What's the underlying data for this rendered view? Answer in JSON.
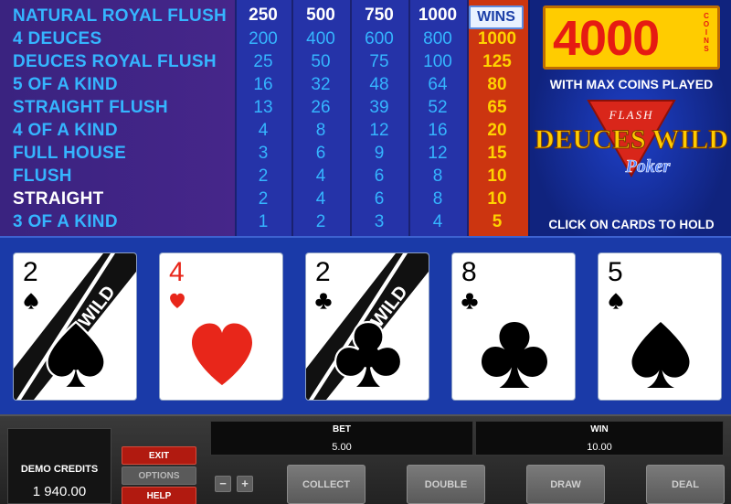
{
  "paytable": {
    "coin_headers": [
      "250",
      "500",
      "750",
      "1000"
    ],
    "wins_label": "WINS",
    "rows": [
      {
        "hand": "NATURAL ROYAL FLUSH",
        "pays": [
          "",
          "",
          "",
          ""
        ],
        "win": ""
      },
      {
        "hand": "4 DEUCES",
        "pays": [
          "200",
          "400",
          "600",
          "800"
        ],
        "win": "1000"
      },
      {
        "hand": "DEUCES ROYAL FLUSH",
        "pays": [
          "25",
          "50",
          "75",
          "100"
        ],
        "win": "125"
      },
      {
        "hand": "5 OF A KIND",
        "pays": [
          "16",
          "32",
          "48",
          "64"
        ],
        "win": "80"
      },
      {
        "hand": "STRAIGHT FLUSH",
        "pays": [
          "13",
          "26",
          "39",
          "52"
        ],
        "win": "65"
      },
      {
        "hand": "4 OF A KIND",
        "pays": [
          "4",
          "8",
          "12",
          "16"
        ],
        "win": "20"
      },
      {
        "hand": "FULL HOUSE",
        "pays": [
          "3",
          "6",
          "9",
          "12"
        ],
        "win": "15"
      },
      {
        "hand": "FLUSH",
        "pays": [
          "2",
          "4",
          "6",
          "8"
        ],
        "win": "10"
      },
      {
        "hand": "STRAIGHT",
        "pays": [
          "2",
          "4",
          "6",
          "8"
        ],
        "win": "10"
      },
      {
        "hand": "3 OF A KIND",
        "pays": [
          "1",
          "2",
          "3",
          "4"
        ],
        "win": "5"
      }
    ],
    "highlighted_row": "STRAIGHT"
  },
  "jackpot": {
    "amount": "4000",
    "unit": "COINS",
    "note": "WITH MAX COINS PLAYED"
  },
  "logo": {
    "flash": "FLASH",
    "title": "DEUCES WILD",
    "subtitle": "Poker"
  },
  "hold_hint": "CLICK ON CARDS TO HOLD",
  "cards": [
    {
      "rank": "2",
      "suit": "spade",
      "wild": true,
      "wild_label": "WILD",
      "color": "#000000"
    },
    {
      "rank": "4",
      "suit": "heart",
      "wild": false,
      "wild_label": "",
      "color": "#e8261a"
    },
    {
      "rank": "2",
      "suit": "club",
      "wild": true,
      "wild_label": "WILD",
      "color": "#000000"
    },
    {
      "rank": "8",
      "suit": "club",
      "wild": false,
      "wild_label": "",
      "color": "#000000"
    },
    {
      "rank": "5",
      "suit": "spade",
      "wild": false,
      "wild_label": "",
      "color": "#000000"
    }
  ],
  "controls": {
    "credits_label": "DEMO CREDITS",
    "credits_value": "1 940.00",
    "exit": "EXIT",
    "options": "OPTIONS",
    "help": "HELP",
    "minus": "−",
    "plus": "+",
    "bet_label": "BET",
    "bet_value": "5.00",
    "win_label": "WIN",
    "win_value": "10.00",
    "collect": "COLLECT",
    "double": "DOUBLE",
    "draw": "DRAW",
    "deal": "DEAL"
  },
  "colors": {
    "hand_text": "#35b5ff",
    "wins_column": "#cc3510",
    "wins_text": "#ffd200",
    "jackpot_bg": "#ffcc00",
    "jackpot_text": "#e61b12"
  }
}
